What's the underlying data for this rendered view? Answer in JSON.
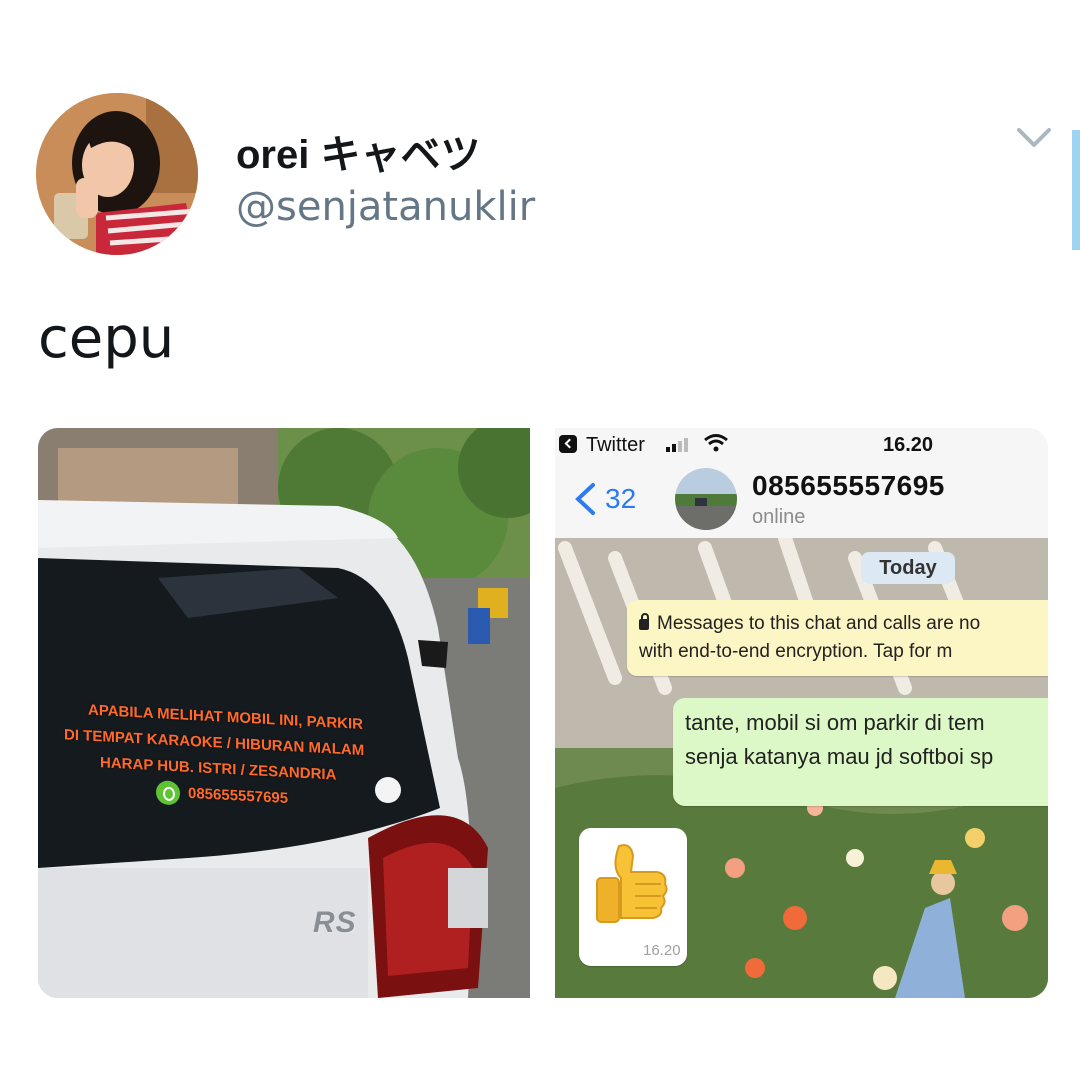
{
  "tweet": {
    "display_name": "orei キャベツ",
    "handle": "@senjatanuklir",
    "text": "cepu"
  },
  "car_photo": {
    "decal_lines": [
      "APABILA MELIHAT MOBIL INI, PARKIR",
      "DI TEMPAT KARAOKE / HIBURAN MALAM",
      "HARAP HUB. ISTRI / ZESANDRIA"
    ],
    "decal_phone": "085655557695",
    "badge": "RS"
  },
  "chat_screenshot": {
    "status_bar": {
      "app": "Twitter",
      "time": "16.20"
    },
    "header": {
      "back_count": "32",
      "contact_name": "085655557695",
      "contact_status": "online"
    },
    "date_pill": "Today",
    "system_note": {
      "line1": "Messages to this chat and calls are no",
      "line2": "with end-to-end encryption. Tap for m"
    },
    "outgoing_message": {
      "line1": "tante, mobil si om parkir di tem",
      "line2": "senja katanya mau jd softboi sp"
    },
    "incoming_message": {
      "emoji": "thumbs-up",
      "time": "16.20"
    }
  },
  "icons": {
    "collapse": "chevron-down-icon",
    "whatsapp": "whatsapp-icon",
    "back": "back-chevron-icon"
  },
  "colors": {
    "name_text": "#14171a",
    "handle_text": "#657786",
    "decal_orange": "#ff6a2a",
    "link_blue": "#2b7cf0",
    "outgoing_bubble": "#dcf8c6",
    "system_note_bg": "#fcf5c4"
  }
}
